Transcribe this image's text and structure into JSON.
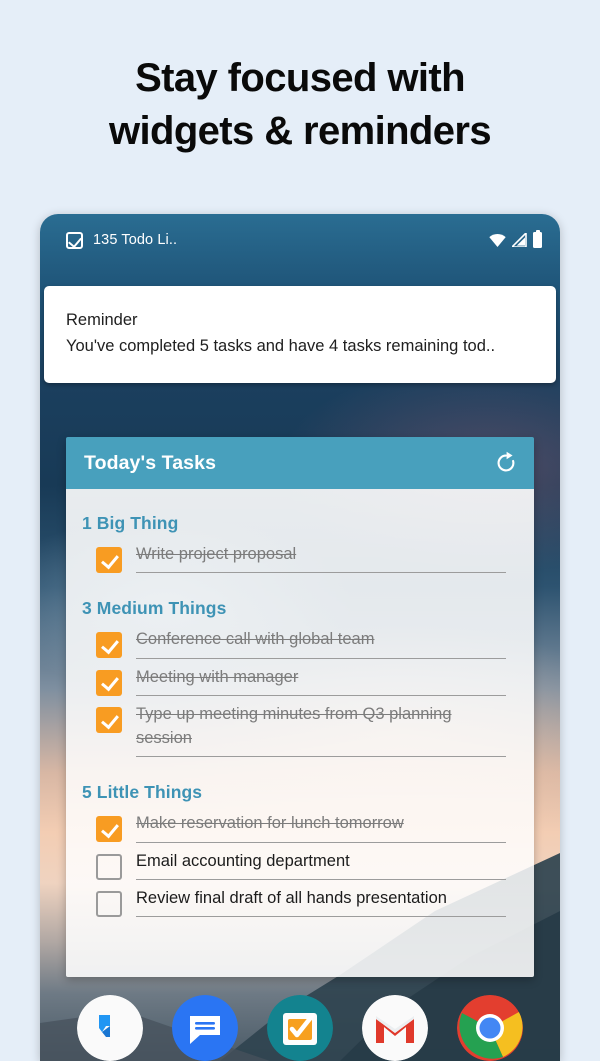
{
  "headline": {
    "line1": "Stay focused with",
    "line2": "widgets & reminders"
  },
  "statusbar": {
    "app_label": "135 Todo Li..",
    "icons": [
      "app-checkbox-icon",
      "wifi-icon",
      "signal-icon",
      "battery-icon"
    ]
  },
  "reminder": {
    "title": "Reminder",
    "body": "You've completed 5 tasks and have 4 tasks remaining tod.."
  },
  "widget": {
    "title": "Today's Tasks",
    "refresh_icon": "refresh-icon",
    "sections": [
      {
        "heading": "1 Big Thing",
        "tasks": [
          {
            "label": "Write project proposal",
            "done": true
          }
        ]
      },
      {
        "heading": "3 Medium Things",
        "tasks": [
          {
            "label": "Conference call with global team",
            "done": true
          },
          {
            "label": "Meeting with manager",
            "done": true
          },
          {
            "label": "Type up meeting minutes from Q3 planning session",
            "done": true
          }
        ]
      },
      {
        "heading": "5 Little Things",
        "tasks": [
          {
            "label": "Make reservation for lunch tomorrow",
            "done": true
          },
          {
            "label": "Email accounting department",
            "done": false
          },
          {
            "label": "Review final draft of all hands presentation",
            "done": false
          }
        ]
      }
    ]
  },
  "dock": {
    "items": [
      {
        "name": "phone-icon",
        "label": "Phone"
      },
      {
        "name": "messages-icon",
        "label": "Messages"
      },
      {
        "name": "todo-app-icon",
        "label": "Todo List"
      },
      {
        "name": "gmail-icon",
        "label": "Gmail"
      },
      {
        "name": "chrome-icon",
        "label": "Chrome"
      }
    ]
  },
  "colors": {
    "page_background": "#e5eef8",
    "widget_header": "#48a0bd",
    "section_heading": "#3e93b5",
    "checkbox_done": "#f89c22",
    "checkbox_todo_border": "#9a9a9a",
    "done_text": "#7c7c7c",
    "todo_text": "#1c1c1c"
  }
}
